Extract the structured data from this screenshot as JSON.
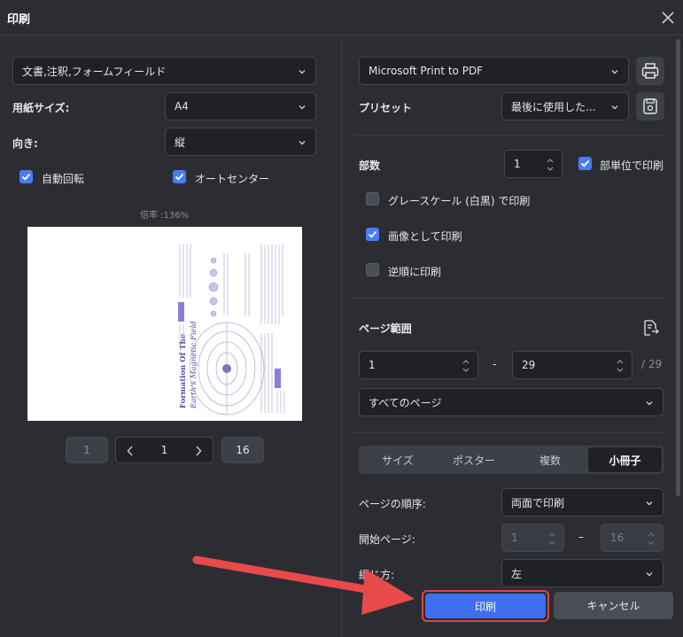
{
  "window": {
    "title": "印刷"
  },
  "left": {
    "content_select": "文書,注釈,フォームフィールド",
    "paper_size_label": "用紙サイズ:",
    "paper_size_value": "A4",
    "orientation_label": "向き:",
    "orientation_value": "縦",
    "auto_rotate": {
      "label": "自動回転",
      "checked": true
    },
    "auto_center": {
      "label": "オートセンター",
      "checked": true
    },
    "zoom_text": "倍率 :136%",
    "preview": {
      "title_line1": "Formation Of The",
      "title_line2": "Earth's Magnetic Field"
    },
    "pager": {
      "first": "1",
      "current": "1",
      "last": "16"
    }
  },
  "right": {
    "printer": "Microsoft Print to PDF",
    "preset_label": "プリセット",
    "preset_value": "最後に使用した...",
    "copies_label": "部数",
    "copies_value": "1",
    "collate": {
      "label": "部単位で印刷",
      "checked": true
    },
    "grayscale": {
      "label": "グレースケール (白黒) で印刷",
      "checked": false
    },
    "as_image": {
      "label": "画像として印刷",
      "checked": true
    },
    "reverse": {
      "label": "逆順に印刷",
      "checked": false
    },
    "page_range_label": "ページ範囲",
    "range_from": "1",
    "range_dash": "-",
    "range_to": "29",
    "range_total": "/ 29",
    "range_select": "すべてのページ",
    "tabs": [
      "サイズ",
      "ポスター",
      "複数",
      "小冊子"
    ],
    "active_tab": "小冊子",
    "page_order_label": "ページの順序:",
    "page_order_value": "両面で印刷",
    "start_page_label": "開始ページ:",
    "start_from": "1",
    "start_dash": "–",
    "start_to": "16",
    "binding_label": "綴じ方:",
    "binding_value": "左"
  },
  "footer": {
    "print": "印刷",
    "cancel": "キャンセル"
  },
  "colors": {
    "accent": "#3d6fef",
    "highlight": "#e04444",
    "background": "#2b2d33"
  }
}
